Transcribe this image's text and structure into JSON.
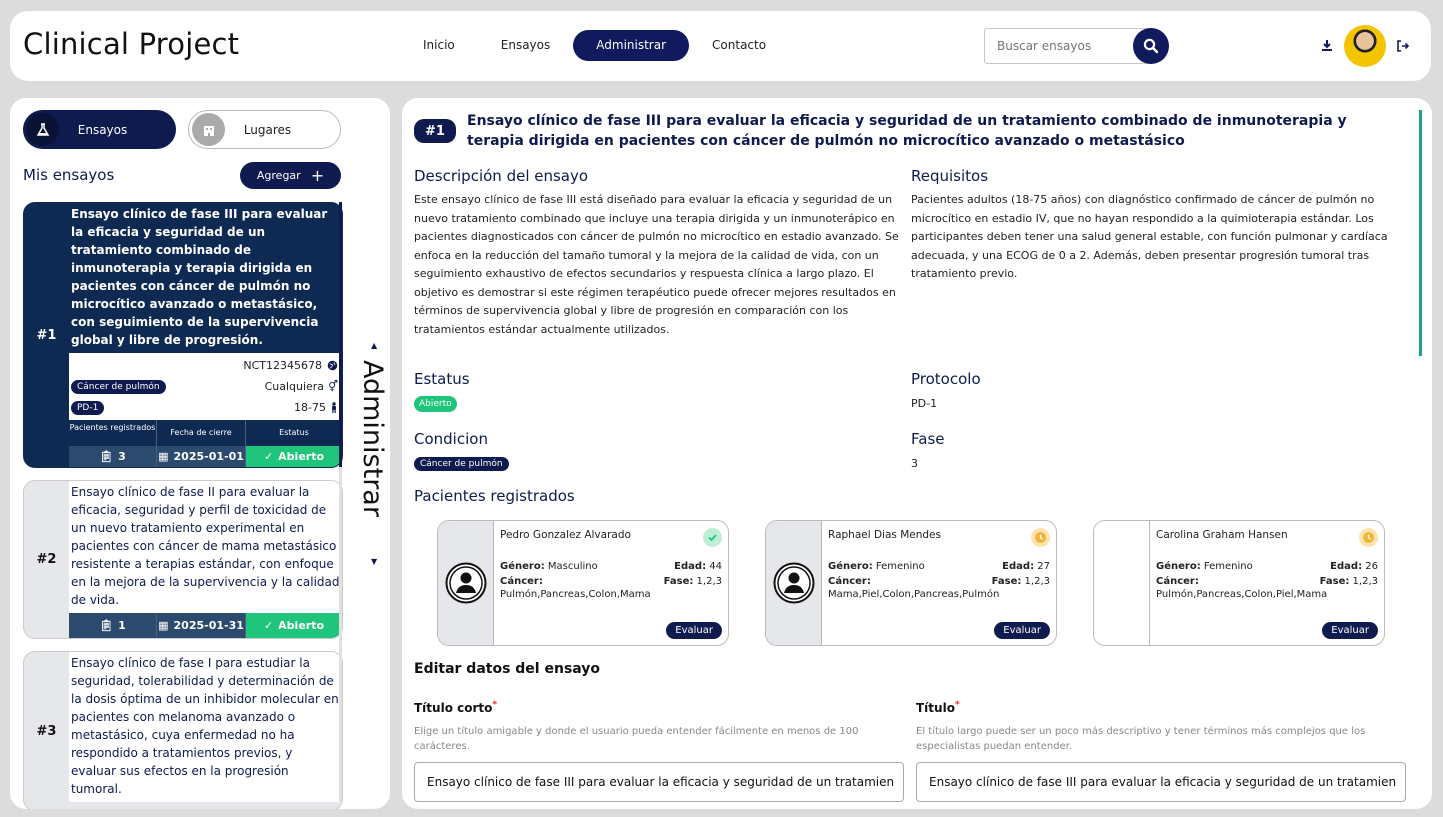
{
  "header": {
    "brand": "Clinical Project",
    "nav": [
      "Inicio",
      "Ensayos",
      "Administrar",
      "Contacto"
    ],
    "search_placeholder": "Buscar ensayos"
  },
  "sidebar": {
    "tabs": [
      "Ensayos",
      "Lugares"
    ],
    "section_title": "Mis ensayos",
    "add_label": "Agregar",
    "vertical_label": "Administrar",
    "trials": [
      {
        "num": "#1",
        "title": "Ensayo clínico de fase III para evaluar la eficacia y seguridad de un tratamiento combinado de inmunoterapia y terapia dirigida en pacientes con cáncer de pulmón no microcítico avanzado o metastásico, con seguimiento de la supervivencia global y libre de progresión.",
        "nct": "NCT12345678",
        "condition": "Cáncer de pulmón",
        "gender": "Cualquiera",
        "protocol": "PD-1",
        "ages": "18-75",
        "stat_headers": [
          "Pacientes registrados",
          "Fecha de cierre",
          "Estatus"
        ],
        "patients": "3",
        "close_date": "2025-01-01",
        "status": "Abierto"
      },
      {
        "num": "#2",
        "title": "Ensayo clínico de fase II para evaluar la eficacia, seguridad y perfil de toxicidad de un nuevo tratamiento experimental en pacientes con cáncer de mama metastásico resistente a terapias estándar, con enfoque en la mejora de la supervivencia y la calidad de vida.",
        "patients": "1",
        "close_date": "2025-01-31",
        "status": "Abierto"
      },
      {
        "num": "#3",
        "title": "Ensayo clínico de fase I para estudiar la seguridad, tolerabilidad y determinación de la dosis óptima de un inhibidor molecular en pacientes con melanoma avanzado o metastásico, cuya enfermedad no ha respondido a tratamientos previos, y evaluar sus efectos en la progresión tumoral."
      }
    ]
  },
  "main": {
    "num": "#1",
    "title": "Ensayo clínico de fase III para evaluar la eficacia y seguridad de un tratamiento combinado de inmunoterapia y terapia dirigida en pacientes con cáncer de pulmón no microcítico avanzado o metastásico",
    "desc_h": "Descripción del ensayo",
    "desc": "Este ensayo clínico de fase III está diseñado para evaluar la eficacia y seguridad de un nuevo tratamiento combinado que incluye una terapia dirigida y un inmunoterápico en pacientes diagnosticados con cáncer de pulmón no microcítico en estadio avanzado. Se enfoca en la reducción del tamaño tumoral y la mejora de la calidad de vida, con un seguimiento exhaustivo de efectos secundarios y respuesta clínica a largo plazo. El objetivo es demostrar si este régimen terapéutico puede ofrecer mejores resultados en términos de supervivencia global y libre de progresión en comparación con los tratamientos estándar actualmente utilizados.",
    "req_h": "Requisitos",
    "req": "Pacientes adultos (18-75 años) con diagnóstico confirmado de cáncer de pulmón no microcítico en estadio IV, que no hayan respondido a la quimioterapia estándar. Los participantes deben tener una salud general estable, con función pulmonar y cardíaca adecuada, y una ECOG de 0 a 2. Además, deben presentar progresión tumoral tras tratamiento previo.",
    "status_h": "Estatus",
    "status": "Abierto",
    "protocol_h": "Protocolo",
    "protocol": "PD-1",
    "condition_h": "Condicion",
    "condition": "Cáncer de pulmón",
    "phase_h": "Fase",
    "phase": "3",
    "patients_h": "Pacientes registrados",
    "patients": [
      {
        "name": "Pedro Gonzalez Alvarado",
        "gender_l": "Género:",
        "gender": "Masculino",
        "age_l": "Edad:",
        "age": "44",
        "cancer_l": "Cáncer:",
        "phase_l": "Fase:",
        "phase": "1,2,3",
        "cancers": "Pulmón,Pancreas,Colon,Mama",
        "eval": "Evaluar",
        "state": "done"
      },
      {
        "name": "Raphael Dias Mendes",
        "gender_l": "Género:",
        "gender": "Femenino",
        "age_l": "Edad:",
        "age": "27",
        "cancer_l": "Cáncer:",
        "phase_l": "Fase:",
        "phase": "1,2,3",
        "cancers": "Mama,Piel,Colon,Pancreas,Pulmón",
        "eval": "Evaluar",
        "state": "pending"
      },
      {
        "name": "Carolina Graham Hansen",
        "gender_l": "Género:",
        "gender": "Femenino",
        "age_l": "Edad:",
        "age": "26",
        "cancer_l": "Cáncer:",
        "phase_l": "Fase:",
        "phase": "1,2,3",
        "cancers": "Pulmón,Pancreas,Colon,Piel,Mama",
        "eval": "Evaluar",
        "state": "pending"
      }
    ],
    "edit_h": "Editar datos del ensayo",
    "short_title_l": "Título corto",
    "short_title_help": "Elige un título amigable y donde el usuario pueda entender fácilmente en menos de 100 carácteres.",
    "short_title_val": "Ensayo clínico de fase III para evaluar la eficacia y seguridad de un tratamien",
    "title_l": "Título",
    "title_help": "El título largo puede ser un poco más descriptivo y tener términos más complejos que los especialistas puedan entender.",
    "title_val": "Ensayo clínico de fase III para evaluar la eficacia y seguridad de un tratamien"
  },
  "colors": {
    "navy": "#0f1a4f",
    "green": "#1ec57a",
    "teal": "#1aa38e",
    "amber": "#f2b53a"
  }
}
